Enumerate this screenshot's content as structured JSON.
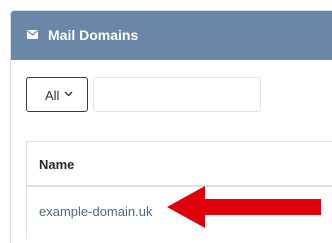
{
  "panel": {
    "title": "Mail Domains",
    "icon": "envelope-icon"
  },
  "filter": {
    "selected": "All"
  },
  "search": {
    "value": "",
    "placeholder": ""
  },
  "table": {
    "columns": [
      "Name"
    ],
    "rows": [
      {
        "name": "example-domain.uk"
      }
    ]
  },
  "colors": {
    "header": "#6b87a7",
    "link": "#4a6a8f",
    "annotation_arrow": "#e0000b"
  }
}
